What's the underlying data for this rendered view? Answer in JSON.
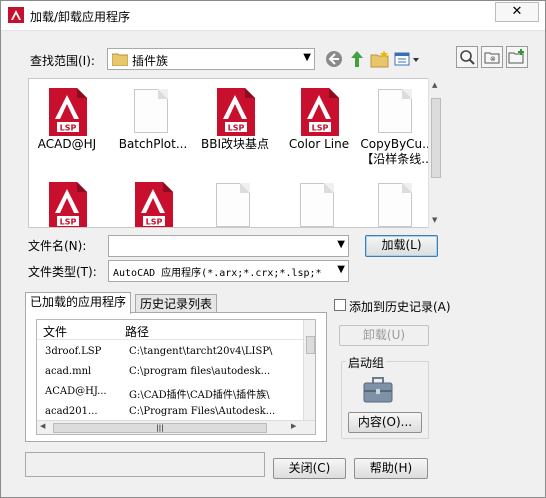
{
  "window": {
    "title": "加载/卸载应用程序",
    "close_label": "✕"
  },
  "lookin": {
    "label": "查找范围(I):",
    "value": "插件族"
  },
  "files": [
    {
      "name": "ACAD@HJ",
      "icon": "lsp-file-icon"
    },
    {
      "name": "BatchPlot...",
      "icon": "blank-file-icon"
    },
    {
      "name": "BBI改块基点",
      "icon": "lsp-file-icon"
    },
    {
      "name": "Color Line",
      "icon": "lsp-file-icon"
    },
    {
      "name": "CopyByCu...",
      "name2": "【沿样条线...",
      "icon": "blank-file-icon"
    },
    {
      "name": "",
      "icon": "lsp-file-icon"
    },
    {
      "name": "",
      "icon": "lsp-file-icon"
    },
    {
      "name": "",
      "icon": "blank-file-icon"
    },
    {
      "name": "",
      "icon": "blank-file-icon"
    },
    {
      "name": "",
      "icon": "blank-file-icon"
    }
  ],
  "lsp_badge": "LSP",
  "filename": {
    "label": "文件名(N):",
    "value": ""
  },
  "filetype": {
    "label": "文件类型(T):",
    "value": "AutoCAD 应用程序(*.arx;*.crx;*.lsp;*"
  },
  "load_button": "加载(L)",
  "tabs": {
    "loaded": "已加载的应用程序",
    "history": "历史记录列表"
  },
  "table": {
    "headers": [
      "文件",
      "路径"
    ],
    "rows": [
      [
        "3droof.LSP",
        "C:\\tangent\\tarcht20v4\\LISP\\"
      ],
      [
        "acad.mnl",
        "C:\\program files\\autodesk..."
      ],
      [
        "ACAD@HJ...",
        "G:\\CAD插件\\CAD插件\\插件族\\"
      ],
      [
        "acad201...",
        "C:\\Program Files\\Autodesk..."
      ]
    ]
  },
  "add_history": "添加到历史记录(A)",
  "unload_button": "卸载(U)",
  "startup": {
    "label": "启动组",
    "contents_button": "内容(O)..."
  },
  "close_button": "关闭(C)",
  "help_button": "帮助(H)",
  "colors": {
    "autocad_red": "#c8102e",
    "accent": "#3c7fb1"
  }
}
